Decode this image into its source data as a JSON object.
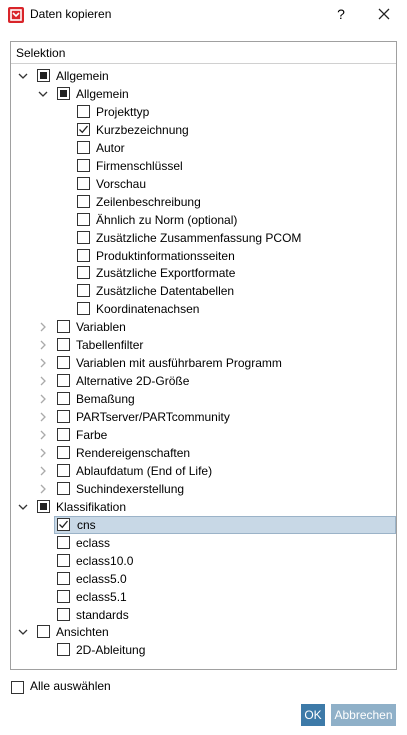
{
  "window": {
    "title": "Daten kopieren",
    "help_label": "?",
    "close_icon": "close-icon",
    "app_icon": "app-logo-icon"
  },
  "panel": {
    "header": "Selektion"
  },
  "tree": [
    {
      "label": "Allgemein",
      "level": 0,
      "expander": "expanded",
      "check": "partial"
    },
    {
      "label": "Allgemein",
      "level": 1,
      "expander": "expanded",
      "check": "partial"
    },
    {
      "label": "Projekttyp",
      "level": 2,
      "expander": "none",
      "check": "unchecked"
    },
    {
      "label": "Kurzbezeichnung",
      "level": 2,
      "expander": "none",
      "check": "checked"
    },
    {
      "label": "Autor",
      "level": 2,
      "expander": "none",
      "check": "unchecked"
    },
    {
      "label": "Firmenschlüssel",
      "level": 2,
      "expander": "none",
      "check": "unchecked"
    },
    {
      "label": "Vorschau",
      "level": 2,
      "expander": "none",
      "check": "unchecked"
    },
    {
      "label": "Zeilenbeschreibung",
      "level": 2,
      "expander": "none",
      "check": "unchecked"
    },
    {
      "label": "Ähnlich zu Norm (optional)",
      "level": 2,
      "expander": "none",
      "check": "unchecked"
    },
    {
      "label": "Zusätzliche Zusammenfassung PCOM",
      "level": 2,
      "expander": "none",
      "check": "unchecked"
    },
    {
      "label": "Produktinformationsseiten",
      "level": 2,
      "expander": "none",
      "check": "unchecked"
    },
    {
      "label": "Zusätzliche Exportformate",
      "level": 2,
      "expander": "none",
      "check": "unchecked"
    },
    {
      "label": "Zusätzliche Datentabellen",
      "level": 2,
      "expander": "none",
      "check": "unchecked"
    },
    {
      "label": "Koordinatenachsen",
      "level": 2,
      "expander": "none",
      "check": "unchecked"
    },
    {
      "label": "Variablen",
      "level": 1,
      "expander": "collapsed",
      "check": "unchecked"
    },
    {
      "label": "Tabellenfilter",
      "level": 1,
      "expander": "collapsed",
      "check": "unchecked"
    },
    {
      "label": "Variablen mit ausführbarem Programm",
      "level": 1,
      "expander": "collapsed",
      "check": "unchecked"
    },
    {
      "label": "Alternative 2D-Größe",
      "level": 1,
      "expander": "collapsed",
      "check": "unchecked"
    },
    {
      "label": "Bemaßung",
      "level": 1,
      "expander": "collapsed",
      "check": "unchecked"
    },
    {
      "label": "PARTserver/PARTcommunity",
      "level": 1,
      "expander": "collapsed",
      "check": "unchecked"
    },
    {
      "label": "Farbe",
      "level": 1,
      "expander": "collapsed",
      "check": "unchecked"
    },
    {
      "label": "Rendereigenschaften",
      "level": 1,
      "expander": "collapsed",
      "check": "unchecked"
    },
    {
      "label": "Ablaufdatum (End of Life)",
      "level": 1,
      "expander": "collapsed",
      "check": "unchecked"
    },
    {
      "label": "Suchindexerstellung",
      "level": 1,
      "expander": "collapsed",
      "check": "unchecked"
    },
    {
      "label": "Klassifikation",
      "level": 0,
      "expander": "expanded",
      "check": "partial"
    },
    {
      "label": "cns",
      "level": 1,
      "expander": "none",
      "check": "checked",
      "selected": true
    },
    {
      "label": "eclass",
      "level": 1,
      "expander": "none",
      "check": "unchecked"
    },
    {
      "label": "eclass10.0",
      "level": 1,
      "expander": "none",
      "check": "unchecked"
    },
    {
      "label": "eclass5.0",
      "level": 1,
      "expander": "none",
      "check": "unchecked"
    },
    {
      "label": "eclass5.1",
      "level": 1,
      "expander": "none",
      "check": "unchecked"
    },
    {
      "label": "standards",
      "level": 1,
      "expander": "none",
      "check": "unchecked"
    },
    {
      "label": "Ansichten",
      "level": 0,
      "expander": "expanded",
      "check": "unchecked"
    },
    {
      "label": "2D-Ableitung",
      "level": 1,
      "expander": "none",
      "check": "unchecked"
    }
  ],
  "footer": {
    "select_all_label": "Alle auswählen",
    "select_all_checked": false,
    "ok_label": "OK",
    "cancel_label": "Abbrechen"
  },
  "colors": {
    "accent": "#3d7aa8",
    "cancel_button": "#8fb0c8",
    "selection": "#c8d8e6",
    "app_icon": "#d9252a"
  }
}
